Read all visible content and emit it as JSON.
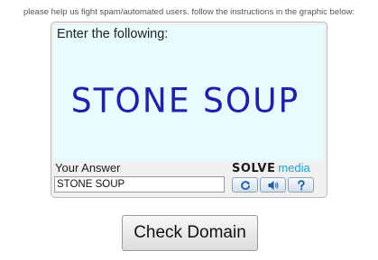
{
  "instructions": "please help us fight spam/automated users. follow the instructions in the graphic below:",
  "captcha": {
    "prompt": "Enter the following:",
    "word": "STONE SOUP",
    "answer_label": "Your Answer",
    "answer_value": "STONE SOUP",
    "brand_solve": "SOLVE",
    "brand_media": "media",
    "icons": [
      "refresh-icon",
      "audio-icon",
      "help-icon"
    ]
  },
  "submit": {
    "label": "Check Domain"
  },
  "colors": {
    "puzzle_background": "#e8fbfd",
    "captcha_text": "#2020a8",
    "brand_accent": "#1aa3d0"
  }
}
